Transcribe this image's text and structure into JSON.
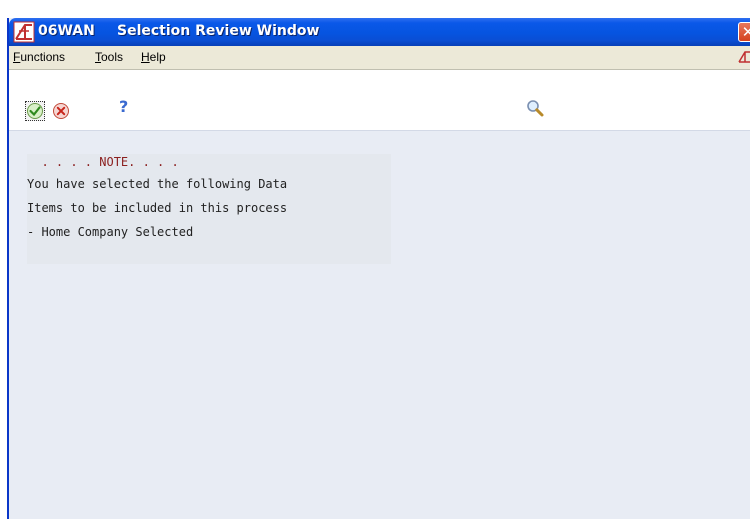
{
  "window": {
    "code": "06WAN",
    "title": "Selection Review Window",
    "close_glyph": "✕"
  },
  "menu": {
    "items": [
      {
        "accel": "F",
        "rest": "unctions"
      },
      {
        "accel": "T",
        "rest": "ools"
      },
      {
        "accel": "H",
        "rest": "elp"
      }
    ]
  },
  "toolbar": {
    "buttons": [
      {
        "icon": "checkmark-icon",
        "tooltip": "OK"
      },
      {
        "icon": "cancel-icon",
        "tooltip": "Cancel"
      },
      {
        "icon": "help-icon",
        "glyph": "?"
      },
      {
        "icon": "search-icon"
      }
    ]
  },
  "note": {
    "title": "  . . . . NOTE. . . .",
    "lines": [
      "You have selected the following Data",
      "Items to be included in this process",
      "- Home Company Selected"
    ]
  },
  "colors": {
    "titlebar": "#0654e0",
    "body_bg": "#e8ecf4",
    "note_title": "#8b1f1f"
  }
}
